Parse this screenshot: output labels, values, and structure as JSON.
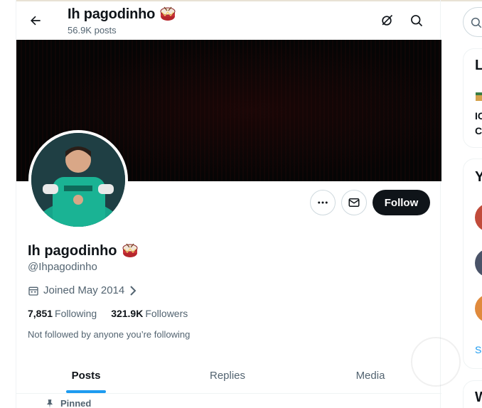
{
  "header": {
    "title": "Ih pagodinho",
    "title_emoji": "drum-emoji",
    "posts_count": "56.9K posts"
  },
  "profile": {
    "display_name": "Ih pagodinho",
    "name_emoji": "drum-emoji",
    "handle": "@Ihpagodinho",
    "joined": "Joined May 2014",
    "following_count": "7,851",
    "following_label": "Following",
    "followers_count": "321.9K",
    "followers_label": "Followers",
    "not_followed_note": "Not followed by anyone you’re following"
  },
  "actions": {
    "follow_label": "Follow",
    "more_icon": "ellipsis-icon",
    "message_icon": "envelope-icon"
  },
  "tabs": [
    {
      "label": "Posts",
      "active": true
    },
    {
      "label": "Replies",
      "active": false
    },
    {
      "label": "Media",
      "active": false
    }
  ],
  "pinned_label": "Pinned",
  "right_sidebar": {
    "panel1_title_fragment": "L",
    "panel1_text_line1": "IC",
    "panel1_text_line2": "C",
    "panel2_title_fragment": "Y",
    "panel2_link_fragment": "S",
    "panel3_title_fragment": "W"
  },
  "colors": {
    "accent": "#1d9bf0",
    "primary_text": "#0f1419",
    "secondary_text": "#536471",
    "follow_button_bg": "#0f1419",
    "banner_bg": "#050505"
  }
}
